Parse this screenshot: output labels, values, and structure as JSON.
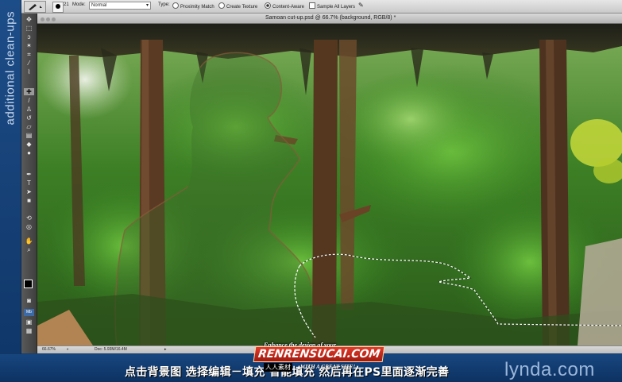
{
  "side_caption": "additional clean-ups",
  "options": {
    "brush_size": "21",
    "mode_label": "Mode:",
    "mode_value": "Normal",
    "type_label": "Type:",
    "proximity_match": "Proximity Match",
    "create_texture": "Create Texture",
    "content_aware": "Content-Aware",
    "selected_type": "Content-Aware",
    "sample_all_layers": "Sample All Layers"
  },
  "document": {
    "title": "Samoan cut-up.psd @ 66.7% (background, RGB/8) *"
  },
  "status": {
    "zoom": "66.67%",
    "doc_info": "Doc: 5.93M/16.4M"
  },
  "subtitle": "点击背景图 选择编辑－填充 智能填充 然后再在PS里面逐渐完善",
  "brand": "lynda.com",
  "watermark": {
    "top": "Enhance the design of your",
    "main": "RENRENSUCAI.COM",
    "sub_left": "人人素材",
    "sub_right": "WITH A GREAT SITE!"
  },
  "colors": {
    "frame_blue": "#123e77",
    "panel_gray": "#c9c9c9",
    "foliage": "#3f8a2b",
    "subtitle_text": "#ffffff"
  },
  "tools": [
    "move-tool",
    "marquee-tool",
    "lasso-tool",
    "quick-selection-tool",
    "crop-tool",
    "eyedropper-tool",
    "spot-healing-tool",
    "brush-tool",
    "clone-stamp-tool",
    "history-brush-tool",
    "eraser-tool",
    "gradient-tool",
    "blur-tool",
    "dodge-tool",
    "pen-tool",
    "type-tool",
    "path-selection-tool",
    "shape-tool",
    "3d-rotate-tool",
    "3d-orbit-tool",
    "hand-tool",
    "zoom-tool"
  ]
}
